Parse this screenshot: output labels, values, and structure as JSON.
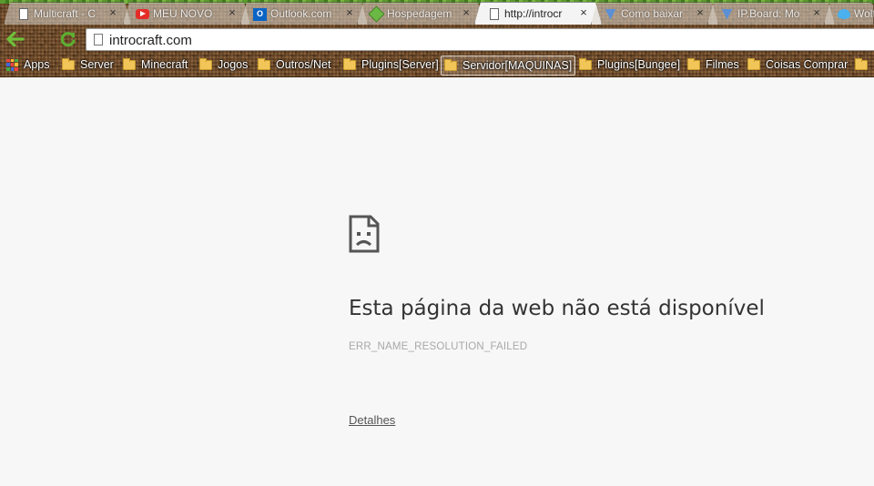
{
  "tabs": [
    {
      "title": "Multicraft - C",
      "favicon": "document-icon",
      "close": "×"
    },
    {
      "title": "MEU NOVO",
      "favicon": "youtube-icon",
      "close": "×"
    },
    {
      "title": "Outlook.com",
      "favicon": "outlook-icon",
      "close": "×"
    },
    {
      "title": "Hospedagem",
      "favicon": "minecraft-block-icon",
      "close": "×"
    },
    {
      "title": "http://introcr",
      "favicon": "document-icon",
      "close": "×",
      "active": true
    },
    {
      "title": "Como baixar",
      "favicon": "ipboard-icon",
      "close": "×"
    },
    {
      "title": "IP.Board: Mo",
      "favicon": "ipboard-icon",
      "close": "×"
    },
    {
      "title": "Wolf",
      "favicon": "twitter-icon",
      "close": ""
    }
  ],
  "toolbar": {
    "back": "back-arrow-icon",
    "reload": "reload-icon",
    "url": "introcraft.com"
  },
  "bookmarks": [
    {
      "label": "Apps",
      "icon": "apps-icon"
    },
    {
      "label": "Server",
      "icon": "folder-icon"
    },
    {
      "label": "Minecraft",
      "icon": "folder-icon"
    },
    {
      "label": "Jogos",
      "icon": "folder-icon"
    },
    {
      "label": "Outros/Net",
      "icon": "folder-icon"
    },
    {
      "label": "Plugins[Server]",
      "icon": "folder-icon"
    },
    {
      "label": "Servidor[MAQUINAS]",
      "icon": "folder-icon",
      "selected": true
    },
    {
      "label": "Plugins[Bungee]",
      "icon": "folder-icon"
    },
    {
      "label": "Filmes",
      "icon": "folder-icon"
    },
    {
      "label": "Coisas Comprar",
      "icon": "folder-icon"
    },
    {
      "label": "",
      "icon": "folder-icon"
    }
  ],
  "error": {
    "icon": "sad-page-icon",
    "title": "Esta página da web não está disponível",
    "code": "ERR_NAME_RESOLUTION_FAILED",
    "details_link": "Detalhes"
  },
  "colors": {
    "page_background": "#f7f7f7",
    "theme_dirt": "#6e4a2a",
    "theme_grass": "#5a9a2e",
    "back_arrow": "#6fbf3a",
    "reload": "#5cb030"
  }
}
